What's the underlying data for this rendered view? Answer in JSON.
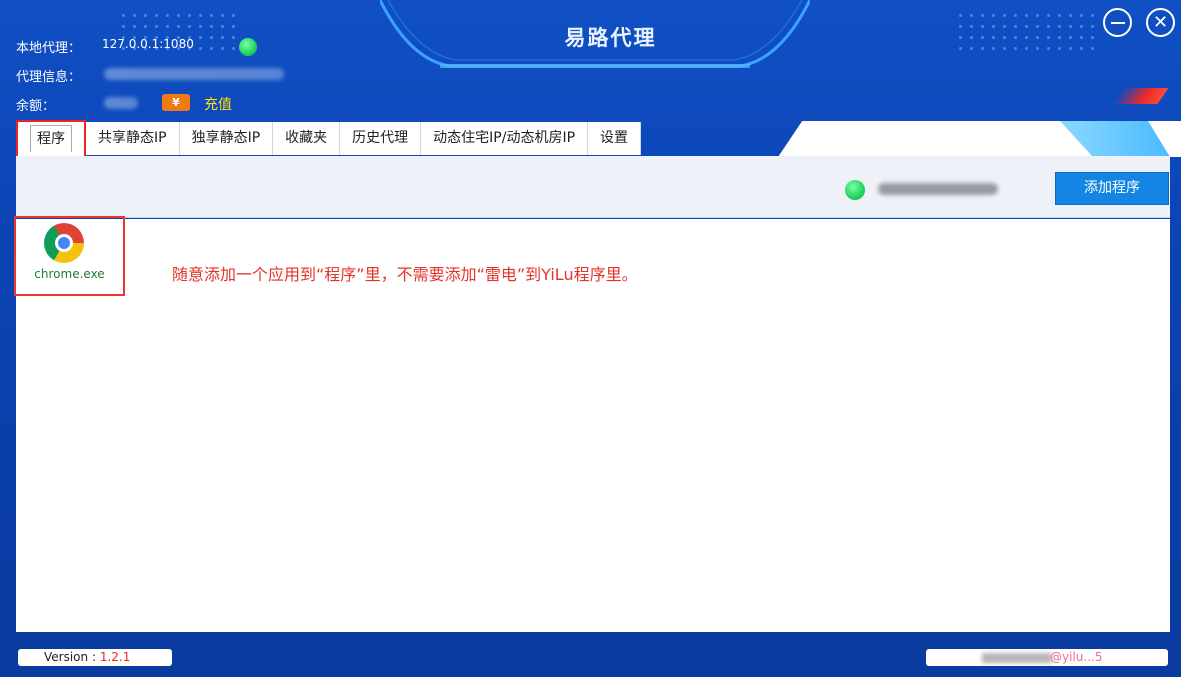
{
  "window": {
    "title": "易路代理",
    "minimize_icon": "minimize-icon",
    "close_icon": "close-icon"
  },
  "info": {
    "local_proxy_label": "本地代理：",
    "local_proxy_value": "127.0.0.1:1080",
    "proxy_info_label": "代理信息：",
    "balance_label": "余额：",
    "yen_symbol": "¥",
    "recharge_label": "充值"
  },
  "tabs": [
    {
      "label": "程序",
      "active": true
    },
    {
      "label": "共享静态IP"
    },
    {
      "label": "独享静态IP"
    },
    {
      "label": "收藏夹"
    },
    {
      "label": "历史代理"
    },
    {
      "label": "动态住宅IP/动态机房IP"
    },
    {
      "label": "设置"
    }
  ],
  "toolbar": {
    "add_program_label": "添加程序"
  },
  "programs": [
    {
      "name": "chrome.exe",
      "icon": "chrome-icon"
    }
  ],
  "note": "随意添加一个应用到“程序”里，不需要添加“雷电”到YiLu程序里。",
  "footer": {
    "version_label": "Version : ",
    "version_value": "1.2.1",
    "handle": "@yilu...5"
  },
  "colors": {
    "background": "#0b42b2",
    "accent_button": "#1485e2",
    "highlight_red": "#e22222",
    "status_green": "#1fd35d",
    "recharge_yellow": "#ffe400",
    "yen_orange": "#f07a12"
  }
}
